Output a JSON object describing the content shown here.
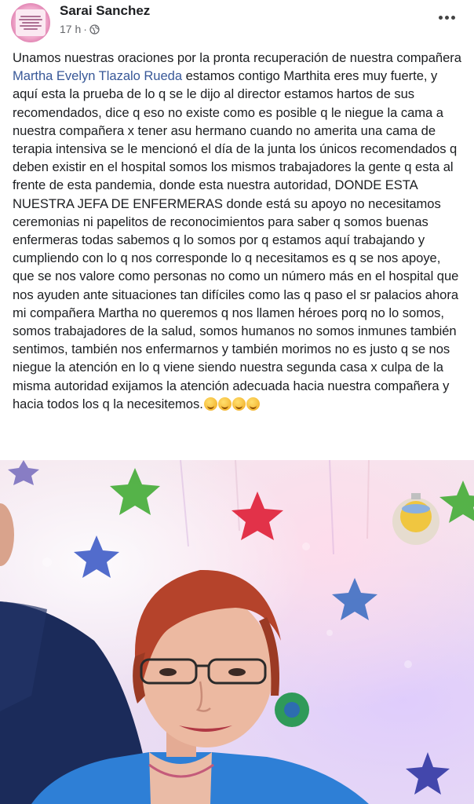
{
  "post": {
    "author": "Sarai Sanchez",
    "time": "17 h",
    "separator": "·",
    "text_before_mention": "Unamos nuestras oraciones por la pronta recuperación de nuestra compañera ",
    "mention": "Martha Evelyn Tlazalo Rueda",
    "text_after_mention": " estamos contigo Marthita eres muy fuerte, y aquí esta la prueba de lo q se le dijo al director estamos hartos de sus recomendados, dice q eso no existe como es posible q le niegue la cama a nuestra compañera x tener asu hermano cuando no amerita una cama de terapia intensiva se le mencionó el día de la junta los únicos recomendados q deben existir en el hospital somos los mismos trabajadores la gente q esta al frente de esta pandemia, donde esta nuestra autoridad, DONDE ESTA NUESTRA JEFA DE ENFERMERAS donde está su apoyo no necesitamos ceremonias ni papelitos de reconocimientos para saber q somos buenas enfermeras todas sabemos q lo somos por q estamos aquí trabajando y cumpliendo con lo q nos corresponde lo q necesitamos es q se nos apoye, que se nos valore como personas no como un número más en el hospital que nos ayuden ante situaciones tan difíciles como las q paso el sr palacios ahora mi compañera Martha no queremos q nos llamen héroes porq no lo somos, somos trabajadores de la salud, somos humanos no somos inmunes también sentimos, también nos enfermarnos y también morimos no es justo q se nos niegue la atención en lo q viene siendo nuestra segunda casa x culpa de la misma autoridad exijamos la atención adecuada hacia nuestra compañera y hacia todos los q la necesitemos.",
    "emoji_icons": [
      "worried-face-icon",
      "worried-face-icon",
      "worried-face-icon",
      "worried-face-icon"
    ]
  },
  "colors": {
    "mention": "#385898",
    "text": "#1c1e21",
    "meta": "#65676b"
  }
}
